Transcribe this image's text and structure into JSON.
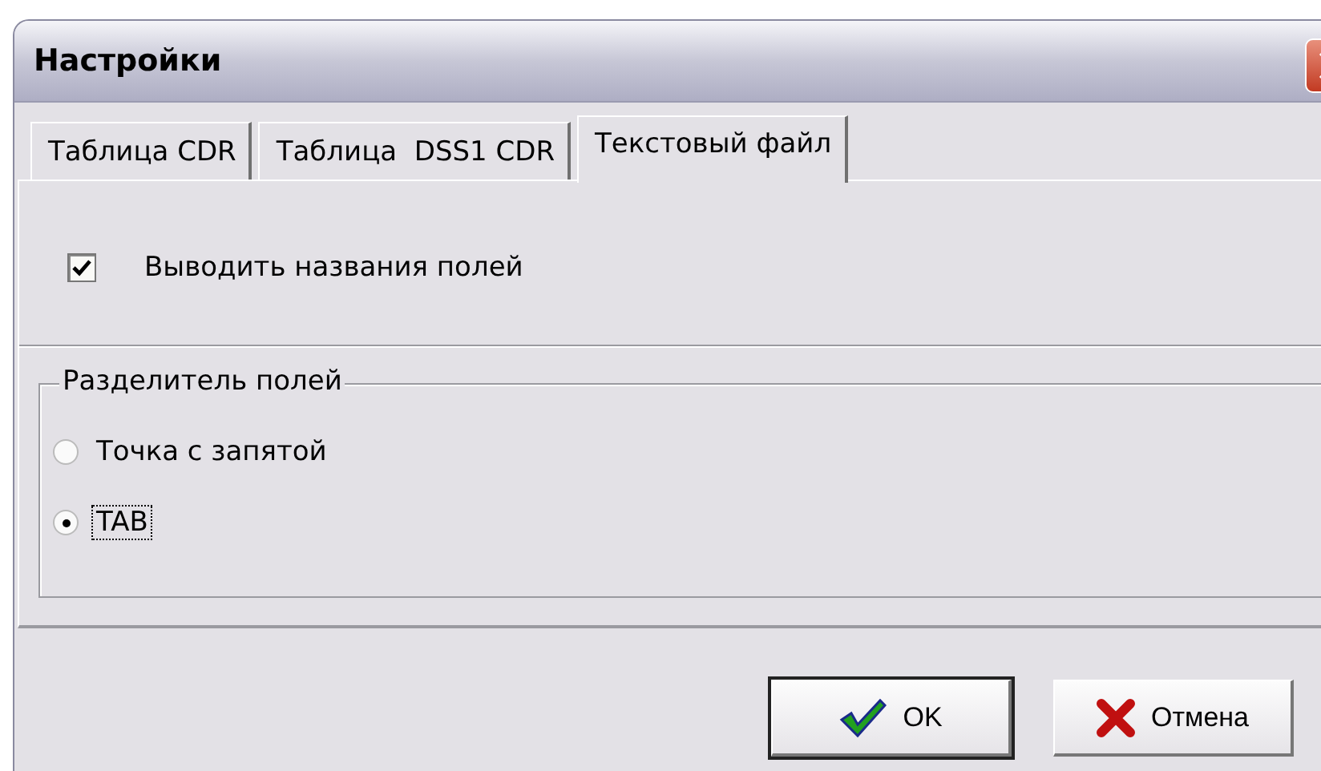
{
  "window": {
    "title": "Настройки"
  },
  "tabs": [
    {
      "label": "Таблица CDR",
      "selected": false
    },
    {
      "label": "Таблица  DSS1 CDR",
      "selected": false
    },
    {
      "label": "Текстовый файл",
      "selected": true
    }
  ],
  "field_names_checkbox": {
    "label": "Выводить названия полей",
    "checked": true
  },
  "separator_group": {
    "title": "Разделитель полей",
    "options": [
      {
        "label": "Точка с запятой",
        "selected": false,
        "focused": false
      },
      {
        "label": "TAB",
        "selected": true,
        "focused": true
      }
    ]
  },
  "buttons": [
    {
      "label": "OK",
      "kind": "ok",
      "default": true
    },
    {
      "label": "Отмена",
      "kind": "cancel",
      "default": false
    }
  ]
}
